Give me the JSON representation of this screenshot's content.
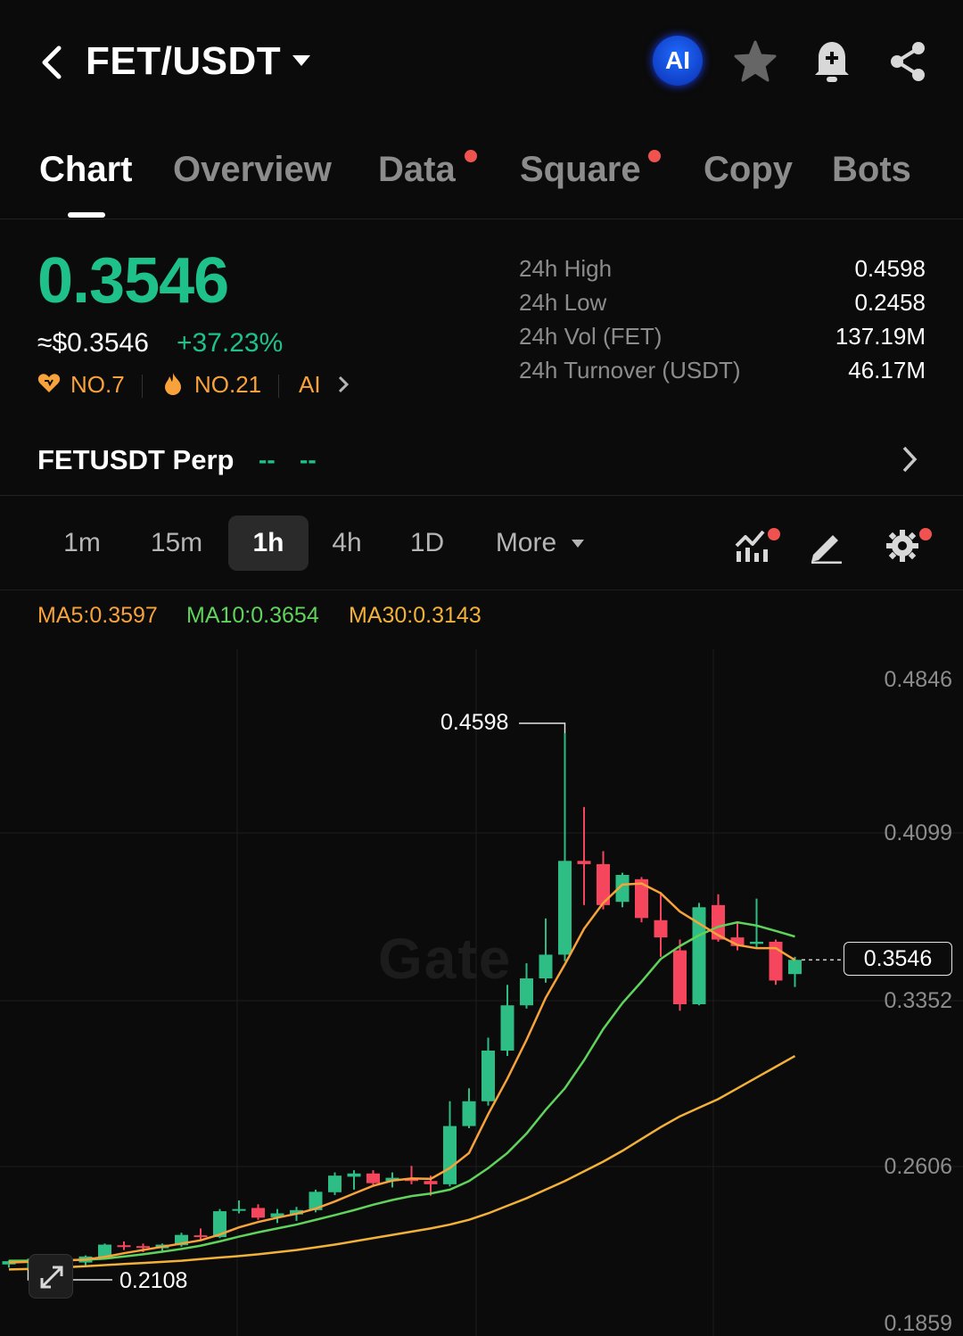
{
  "header": {
    "pair": "FET/USDT",
    "ai_label": "AI"
  },
  "tabs": [
    {
      "label": "Chart",
      "active": true,
      "dot": false
    },
    {
      "label": "Overview",
      "active": false,
      "dot": false
    },
    {
      "label": "Data",
      "active": false,
      "dot": true
    },
    {
      "label": "Square",
      "active": false,
      "dot": true
    },
    {
      "label": "Copy",
      "active": false,
      "dot": false
    },
    {
      "label": "Bots",
      "active": false,
      "dot": false
    }
  ],
  "price": {
    "last": "0.3546",
    "usd": "≈$0.3546",
    "change": "+37.23%",
    "rank1": "NO.7",
    "rank2": "NO.21",
    "category": "AI"
  },
  "stats": [
    {
      "label": "24h High",
      "value": "0.4598"
    },
    {
      "label": "24h Low",
      "value": "0.2458"
    },
    {
      "label": "24h Vol (FET)",
      "value": "137.19M"
    },
    {
      "label": "24h Turnover (USDT)",
      "value": "46.17M"
    }
  ],
  "perp": {
    "name": "FETUSDT Perp",
    "val1": "--",
    "val2": "--"
  },
  "intervals": {
    "items": [
      "1m",
      "15m",
      "1h",
      "4h",
      "1D"
    ],
    "active": "1h",
    "more": "More"
  },
  "ma": {
    "ma5": "MA5:0.3597",
    "ma10": "MA10:0.3654",
    "ma30": "MA30:0.3143"
  },
  "colors": {
    "up": "#2ebd85",
    "down": "#f6465d",
    "ma5": "#f7a23b",
    "ma10": "#5fd35b",
    "ma30": "#f2b138"
  },
  "chart_data": {
    "type": "candlestick",
    "y_ticks": [
      "0.4846",
      "0.4099",
      "0.3352",
      "0.2606",
      "0.1859"
    ],
    "ylim": [
      0.1859,
      0.4846
    ],
    "high_marker": "0.4598",
    "low_marker": "0.2108",
    "current_price": "0.3546",
    "watermark": "Gate",
    "candles": [
      {
        "o": 0.2133,
        "h": 0.2152,
        "l": 0.2118,
        "c": 0.2148
      },
      {
        "o": 0.214,
        "h": 0.216,
        "l": 0.2108,
        "c": 0.2155
      },
      {
        "o": 0.215,
        "h": 0.2162,
        "l": 0.2132,
        "c": 0.214
      },
      {
        "o": 0.2138,
        "h": 0.216,
        "l": 0.2122,
        "c": 0.2145
      },
      {
        "o": 0.2142,
        "h": 0.2175,
        "l": 0.213,
        "c": 0.217
      },
      {
        "o": 0.2168,
        "h": 0.223,
        "l": 0.216,
        "c": 0.2225
      },
      {
        "o": 0.2222,
        "h": 0.224,
        "l": 0.22,
        "c": 0.2215
      },
      {
        "o": 0.2218,
        "h": 0.223,
        "l": 0.219,
        "c": 0.221
      },
      {
        "o": 0.2208,
        "h": 0.223,
        "l": 0.2195,
        "c": 0.2225
      },
      {
        "o": 0.2222,
        "h": 0.228,
        "l": 0.2215,
        "c": 0.227
      },
      {
        "o": 0.2268,
        "h": 0.23,
        "l": 0.2245,
        "c": 0.2262
      },
      {
        "o": 0.226,
        "h": 0.239,
        "l": 0.2255,
        "c": 0.238
      },
      {
        "o": 0.2385,
        "h": 0.243,
        "l": 0.237,
        "c": 0.239
      },
      {
        "o": 0.2395,
        "h": 0.2412,
        "l": 0.234,
        "c": 0.235
      },
      {
        "o": 0.2352,
        "h": 0.239,
        "l": 0.2325,
        "c": 0.237
      },
      {
        "o": 0.2365,
        "h": 0.24,
        "l": 0.2335,
        "c": 0.2385
      },
      {
        "o": 0.2385,
        "h": 0.248,
        "l": 0.2375,
        "c": 0.247
      },
      {
        "o": 0.2468,
        "h": 0.256,
        "l": 0.2455,
        "c": 0.2545
      },
      {
        "o": 0.254,
        "h": 0.257,
        "l": 0.248,
        "c": 0.2555
      },
      {
        "o": 0.2555,
        "h": 0.257,
        "l": 0.25,
        "c": 0.251
      },
      {
        "o": 0.252,
        "h": 0.256,
        "l": 0.249,
        "c": 0.2535
      },
      {
        "o": 0.253,
        "h": 0.259,
        "l": 0.2505,
        "c": 0.252
      },
      {
        "o": 0.252,
        "h": 0.2545,
        "l": 0.2452,
        "c": 0.2505
      },
      {
        "o": 0.2505,
        "h": 0.289,
        "l": 0.2495,
        "c": 0.2775
      },
      {
        "o": 0.2775,
        "h": 0.295,
        "l": 0.2765,
        "c": 0.289
      },
      {
        "o": 0.289,
        "h": 0.3185,
        "l": 0.287,
        "c": 0.3125
      },
      {
        "o": 0.3125,
        "h": 0.343,
        "l": 0.31,
        "c": 0.3335
      },
      {
        "o": 0.3335,
        "h": 0.353,
        "l": 0.332,
        "c": 0.346
      },
      {
        "o": 0.346,
        "h": 0.3738,
        "l": 0.344,
        "c": 0.357
      },
      {
        "o": 0.357,
        "h": 0.4598,
        "l": 0.354,
        "c": 0.4005
      },
      {
        "o": 0.4005,
        "h": 0.4255,
        "l": 0.38,
        "c": 0.399
      },
      {
        "o": 0.399,
        "h": 0.405,
        "l": 0.378,
        "c": 0.38
      },
      {
        "o": 0.3815,
        "h": 0.395,
        "l": 0.379,
        "c": 0.394
      },
      {
        "o": 0.392,
        "h": 0.393,
        "l": 0.372,
        "c": 0.374
      },
      {
        "o": 0.373,
        "h": 0.386,
        "l": 0.356,
        "c": 0.365
      },
      {
        "o": 0.359,
        "h": 0.364,
        "l": 0.331,
        "c": 0.334
      },
      {
        "o": 0.334,
        "h": 0.381,
        "l": 0.3335,
        "c": 0.379
      },
      {
        "o": 0.38,
        "h": 0.385,
        "l": 0.363,
        "c": 0.364
      },
      {
        "o": 0.365,
        "h": 0.372,
        "l": 0.359,
        "c": 0.361
      },
      {
        "o": 0.362,
        "h": 0.383,
        "l": 0.36,
        "c": 0.363
      },
      {
        "o": 0.363,
        "h": 0.364,
        "l": 0.343,
        "c": 0.345
      },
      {
        "o": 0.348,
        "h": 0.356,
        "l": 0.342,
        "c": 0.3546
      }
    ],
    "ma5_series": [
      0.2142,
      0.2145,
      0.2148,
      0.2152,
      0.2156,
      0.2168,
      0.2185,
      0.22,
      0.2215,
      0.223,
      0.2245,
      0.2272,
      0.2305,
      0.233,
      0.235,
      0.2368,
      0.2392,
      0.2425,
      0.2462,
      0.2498,
      0.2522,
      0.2532,
      0.253,
      0.258,
      0.265,
      0.283,
      0.2995,
      0.3175,
      0.337,
      0.3525,
      0.369,
      0.381,
      0.3895,
      0.39,
      0.3855,
      0.377,
      0.3715,
      0.366,
      0.3615,
      0.36,
      0.36,
      0.3545
    ],
    "ma10_series": [
      0.215,
      0.215,
      0.215,
      0.2152,
      0.2155,
      0.216,
      0.217,
      0.218,
      0.2192,
      0.2205,
      0.222,
      0.224,
      0.2262,
      0.2282,
      0.23,
      0.2318,
      0.234,
      0.2362,
      0.2385,
      0.241,
      0.2432,
      0.245,
      0.2462,
      0.248,
      0.252,
      0.258,
      0.265,
      0.274,
      0.285,
      0.295,
      0.308,
      0.3225,
      0.3345,
      0.3445,
      0.355,
      0.361,
      0.366,
      0.37,
      0.372,
      0.3705,
      0.368,
      0.3654
    ],
    "ma30_series": [
      0.211,
      0.2112,
      0.2115,
      0.212,
      0.2125,
      0.213,
      0.2135,
      0.214,
      0.2145,
      0.215,
      0.2158,
      0.2165,
      0.2172,
      0.218,
      0.219,
      0.22,
      0.2212,
      0.2225,
      0.224,
      0.2255,
      0.227,
      0.2285,
      0.23,
      0.2318,
      0.234,
      0.237,
      0.2405,
      0.244,
      0.248,
      0.252,
      0.2565,
      0.261,
      0.266,
      0.2715,
      0.277,
      0.282,
      0.286,
      0.29,
      0.295,
      0.3,
      0.305,
      0.31
    ]
  }
}
